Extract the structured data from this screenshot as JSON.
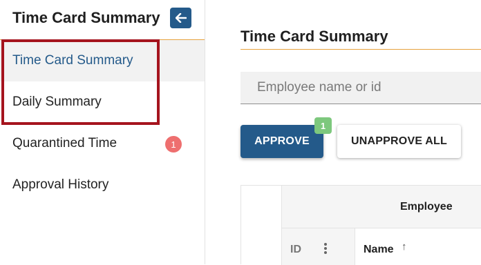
{
  "sidebar": {
    "title": "Time Card Summary",
    "collapse_icon": "arrow-left-icon",
    "items": [
      {
        "label": "Time Card Summary",
        "active": true
      },
      {
        "label": "Daily Summary",
        "active": false
      },
      {
        "label": "Quarantined Time",
        "badge": "1"
      },
      {
        "label": "Approval History"
      }
    ]
  },
  "main": {
    "title": "Time Card Summary",
    "search": {
      "placeholder": "Employee name or id",
      "value": ""
    },
    "approve_label": "APPROVE",
    "approve_badge": "1",
    "unapprove_label": "UNAPPROVE ALL",
    "table": {
      "group_header": "Employee",
      "columns": [
        {
          "label": "ID",
          "menu_icon": "more-vertical-icon"
        },
        {
          "label": "Name",
          "sort_icon": "sort-ascending-icon",
          "sort_symbol": "↑"
        }
      ]
    }
  },
  "colors": {
    "accent": "#245a8a",
    "rule": "#e6a23c",
    "badge_red": "#ee6f6f",
    "badge_green": "#7dc87d",
    "highlight_box": "#a5141e"
  }
}
